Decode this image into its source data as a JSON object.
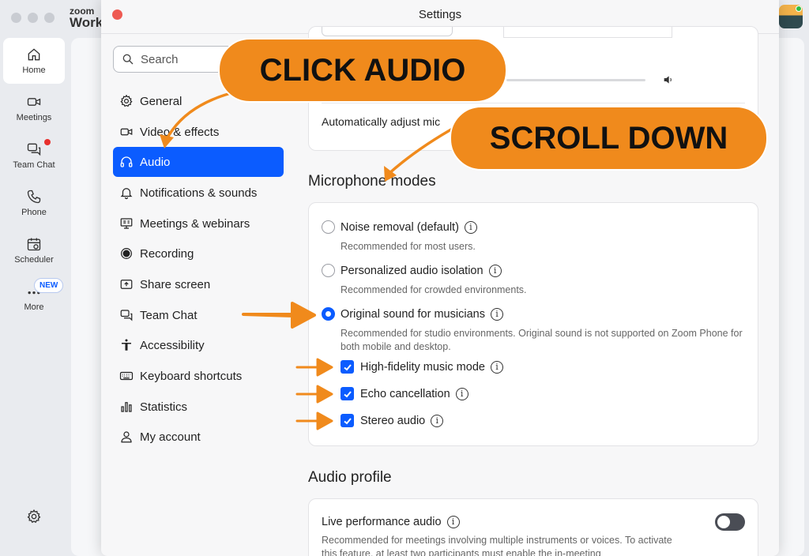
{
  "background_app": {
    "logo_line1": "zoom",
    "logo_line2": "Work",
    "rail": [
      {
        "label": "Home",
        "icon": "home-icon"
      },
      {
        "label": "Meetings",
        "icon": "video-camera-icon"
      },
      {
        "label": "Team Chat",
        "icon": "chat-icon"
      },
      {
        "label": "Phone",
        "icon": "phone-icon"
      },
      {
        "label": "Scheduler",
        "icon": "calendar-icon"
      },
      {
        "label": "More",
        "icon": "more-dots-icon"
      }
    ],
    "new_badge": "NEW"
  },
  "dialog": {
    "title": "Settings",
    "search_placeholder": "Search",
    "nav": [
      {
        "label": "General",
        "icon": "gear-icon"
      },
      {
        "label": "Video & effects",
        "icon": "video-camera-icon"
      },
      {
        "label": "Audio",
        "icon": "headphones-icon"
      },
      {
        "label": "Notifications & sounds",
        "icon": "bell-icon"
      },
      {
        "label": "Meetings & webinars",
        "icon": "presentation-icon"
      },
      {
        "label": "Recording",
        "icon": "record-icon"
      },
      {
        "label": "Share screen",
        "icon": "share-screen-icon"
      },
      {
        "label": "Team Chat",
        "icon": "chat-icon"
      },
      {
        "label": "Accessibility",
        "icon": "accessibility-icon"
      },
      {
        "label": "Keyboard shortcuts",
        "icon": "keyboard-icon"
      },
      {
        "label": "Statistics",
        "icon": "bar-chart-icon"
      },
      {
        "label": "My account",
        "icon": "user-icon"
      }
    ],
    "active_nav": "Audio"
  },
  "content": {
    "auto_adjust_label": "Automatically adjust mic",
    "microphone_modes_title": "Microphone modes",
    "modes": [
      {
        "label": "Noise removal (default)",
        "desc": "Recommended for most users.",
        "selected": false
      },
      {
        "label": "Personalized audio isolation",
        "desc": "Recommended for crowded environments.",
        "selected": false
      },
      {
        "label": "Original sound for musicians",
        "desc": "Recommended for studio environments. Original sound is not supported on Zoom Phone for both mobile and desktop.",
        "selected": true
      }
    ],
    "options": [
      {
        "label": "High-fidelity music mode",
        "checked": true
      },
      {
        "label": "Echo cancellation",
        "checked": true
      },
      {
        "label": "Stereo audio",
        "checked": true
      }
    ],
    "audio_profile_title": "Audio profile",
    "live_performance_label": "Live performance audio",
    "live_performance_desc": "Recommended for meetings involving multiple instruments or voices. To activate this feature, at least two participants must enable the in-meeting",
    "live_performance_enabled": false,
    "info_symbol": "i"
  },
  "annotations": {
    "click_audio": "CLICK AUDIO",
    "scroll_down": "SCROLL DOWN",
    "accent_color": "#f08a1c"
  },
  "colors": {
    "primary_blue": "#0b5cff",
    "close_red": "#ee5a52",
    "badge_red": "#e8302d"
  }
}
